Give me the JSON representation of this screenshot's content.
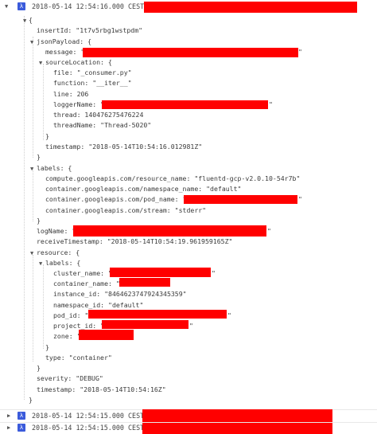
{
  "log_entries": [
    {
      "timestamp_label": "2018-05-14 12:54:16.000 CEST",
      "severity_icon": "lambda-icon",
      "expanded": true
    },
    {
      "timestamp_label": "2018-05-14 12:54:15.000 CEST",
      "severity_icon": "lambda-icon",
      "expanded": false
    },
    {
      "timestamp_label": "2018-05-14 12:54:15.000 CEST",
      "severity_icon": "lambda-icon",
      "expanded": false
    }
  ],
  "tree": {
    "open_brace": "{",
    "close_brace": "}",
    "insertId": "insertId: \"1t7v5rbg1wstpdm\"",
    "jsonPayload_label": "jsonPayload: {",
    "message_label": "message: \"",
    "sourceLocation_label": "sourceLocation: {",
    "file": "file: \"_consumer.py\"",
    "function": "function: \"__iter__\"",
    "line": "line: 206",
    "loggerName_label": "loggerName: \"",
    "thread": "thread: 140476275476224",
    "threadName": "threadName: \"Thread-5020\"",
    "payload_timestamp": "timestamp: \"2018-05-14T10:54:16.012981Z\"",
    "labels_label": "labels: {",
    "resource_name": "compute.googleapis.com/resource_name: \"fluentd-gcp-v2.0.10-54r7b\"",
    "namespace_name": "container.googleapis.com/namespace_name: \"default\"",
    "pod_name_label": "container.googleapis.com/pod_name: \"",
    "stream": "container.googleapis.com/stream: \"stderr\"",
    "logName_label": "logName: \"",
    "receiveTimestamp": "receiveTimestamp: \"2018-05-14T10:54:19.961959165Z\"",
    "resource_label": "resource: {",
    "resource_labels_label": "labels: {",
    "cluster_name_label": "cluster_name: \"",
    "container_name_label": "container_name: \"",
    "instance_id": "instance_id: \"8464623747924345359\"",
    "namespace_id": "namespace_id: \"default\"",
    "pod_id_label": "pod_id: \"",
    "project_id_label": "project_id: \"",
    "zone_label": "zone: \"",
    "type": "type: \"container\"",
    "severity": "severity: \"DEBUG\"",
    "timestamp": "timestamp: \"2018-05-14T10:54:16Z\"",
    "close_quote": "\""
  }
}
